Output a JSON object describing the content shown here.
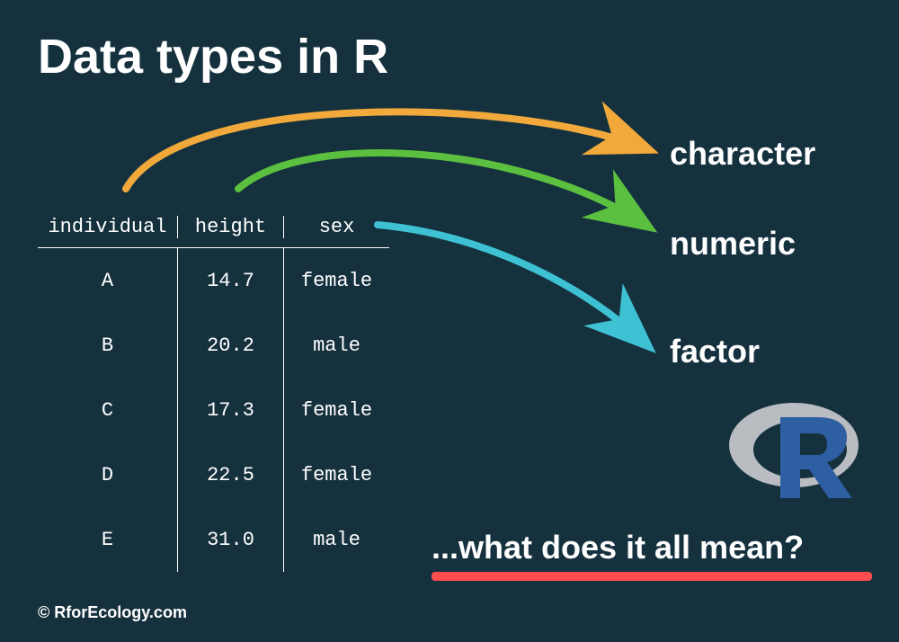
{
  "title": "Data types in R",
  "table": {
    "headers": [
      "individual",
      "height",
      "sex"
    ],
    "rows": [
      {
        "individual": "A",
        "height": "14.7",
        "sex": "female"
      },
      {
        "individual": "B",
        "height": "20.2",
        "sex": "male"
      },
      {
        "individual": "C",
        "height": "17.3",
        "sex": "female"
      },
      {
        "individual": "D",
        "height": "22.5",
        "sex": "female"
      },
      {
        "individual": "E",
        "height": "31.0",
        "sex": "male"
      }
    ]
  },
  "types": {
    "character": "character",
    "numeric": "numeric",
    "factor": "factor"
  },
  "subtitle": "...what does it all mean?",
  "credit": "© RforEcology.com",
  "colors": {
    "bg": "#15313e",
    "arrow_orange": "#f0a93a",
    "arrow_green": "#5bbf3f",
    "arrow_cyan": "#3ec1d3",
    "underline": "#ff4d4d",
    "r_blue": "#2e5fa3",
    "r_gray": "#b9bcc0"
  }
}
